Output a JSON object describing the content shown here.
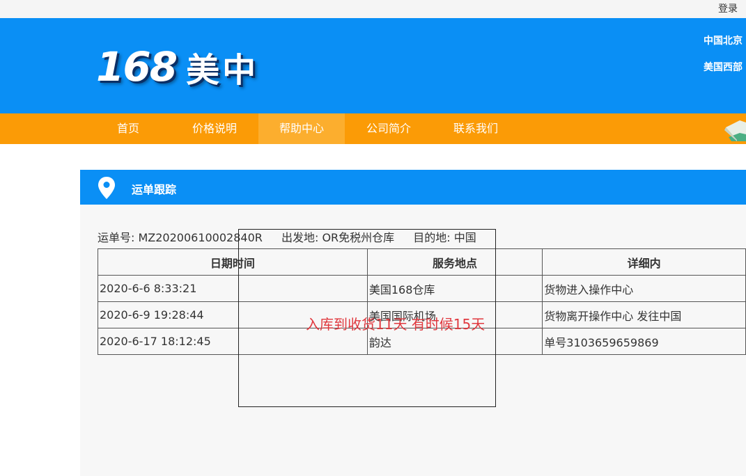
{
  "topbar": {
    "login_label": "登录"
  },
  "header": {
    "logo_number": "168",
    "logo_text": "美中",
    "regions": [
      "中国北京",
      "美国西部"
    ]
  },
  "nav": {
    "items": [
      "首页",
      "价格说明",
      "帮助中心",
      "公司简介",
      "联系我们"
    ],
    "active_index": 2
  },
  "panel": {
    "title": "运单跟踪",
    "pin_icon": "location-pin-icon"
  },
  "waybill": {
    "number_label": "运单号: MZ20200610002840R",
    "origin_label": "出发地: OR免税州仓库",
    "destination_label": "目的地: 中国"
  },
  "table": {
    "headers": [
      "日期时间",
      "服务地点",
      "详细内"
    ],
    "rows": [
      [
        "2020-6-6 8:33:21",
        "美国168仓库",
        "货物进入操作中心"
      ],
      [
        "2020-6-9 19:28:44",
        "美国国际机场",
        "货物离开操作中心 发往中国"
      ],
      [
        "2020-6-17 18:12:45",
        "韵达",
        "单号3103659659869"
      ]
    ]
  },
  "overlay": {
    "note": "入库到收货11天 有时候15天"
  },
  "colors": {
    "header_blue": "#0a8ff5",
    "nav_orange": "#fb9b06",
    "nav_active": "#fcae2e",
    "note_red": "#e0393f"
  }
}
